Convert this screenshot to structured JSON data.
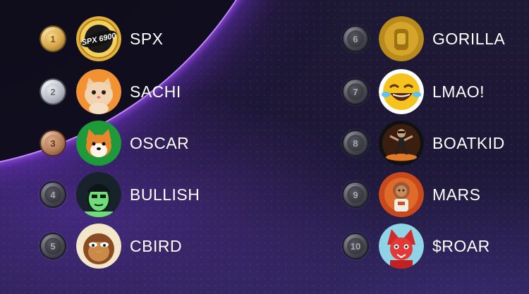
{
  "leaderboard": {
    "left": [
      {
        "rank": "1",
        "name": "SPX",
        "icon": "spx6900-coin-icon",
        "medal": "gold"
      },
      {
        "rank": "2",
        "name": "SACHI",
        "icon": "kitten-icon",
        "medal": "silver"
      },
      {
        "rank": "3",
        "name": "OSCAR",
        "icon": "shiba-dog-icon",
        "medal": "bronze"
      },
      {
        "rank": "4",
        "name": "BULLISH",
        "icon": "green-beanie-guy-icon",
        "medal": "dark"
      },
      {
        "rank": "5",
        "name": "CBIRD",
        "icon": "brown-bird-icon",
        "medal": "dark"
      }
    ],
    "right": [
      {
        "rank": "6",
        "name": "GORILLA",
        "icon": "gold-gorilla-icon",
        "medal": "dark"
      },
      {
        "rank": "7",
        "name": "LMAO!",
        "icon": "laughing-emoji-icon",
        "medal": "dark"
      },
      {
        "rank": "8",
        "name": "BOATKID",
        "icon": "surfing-kid-icon",
        "medal": "dark"
      },
      {
        "rank": "9",
        "name": "MARS",
        "icon": "mars-astronaut-icon",
        "medal": "dark"
      },
      {
        "rank": "10",
        "name": "$ROAR",
        "icon": "red-lion-icon",
        "medal": "dark"
      }
    ]
  },
  "logo_text": "SPX 6900"
}
